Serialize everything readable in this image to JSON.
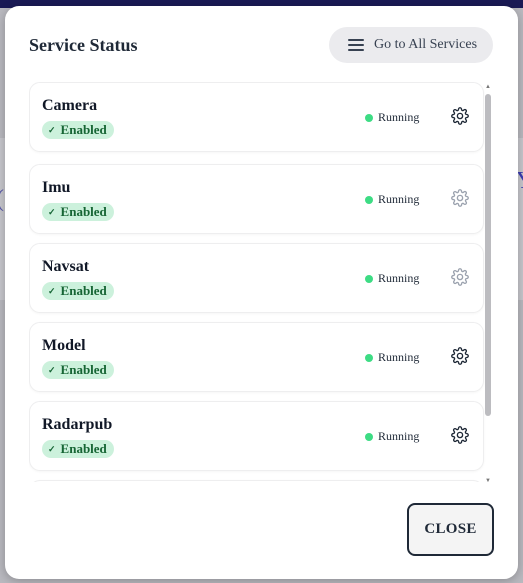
{
  "dialog": {
    "title": "Service Status",
    "go_all_label": "Go to All Services",
    "close_label": "CLOSE"
  },
  "services": [
    {
      "name": "Camera",
      "state": "Enabled",
      "status": "Running",
      "gear": "active"
    },
    {
      "name": "Imu",
      "state": "Enabled",
      "status": "Running",
      "gear": "muted"
    },
    {
      "name": "Navsat",
      "state": "Enabled",
      "status": "Running",
      "gear": "muted"
    },
    {
      "name": "Model",
      "state": "Enabled",
      "status": "Running",
      "gear": "active"
    },
    {
      "name": "Radarpub",
      "state": "Enabled",
      "status": "Running",
      "gear": "active"
    }
  ],
  "colors": {
    "running_dot": "#3ddc84",
    "enabled_badge_bg": "#ccf1dc",
    "enabled_badge_text": "#166534",
    "gear_active": "#1f2937",
    "gear_muted": "#9ca3af"
  },
  "icons": {
    "menu": "menu-icon",
    "check": "check-icon",
    "gear": "gear-icon",
    "status": "status-dot"
  }
}
